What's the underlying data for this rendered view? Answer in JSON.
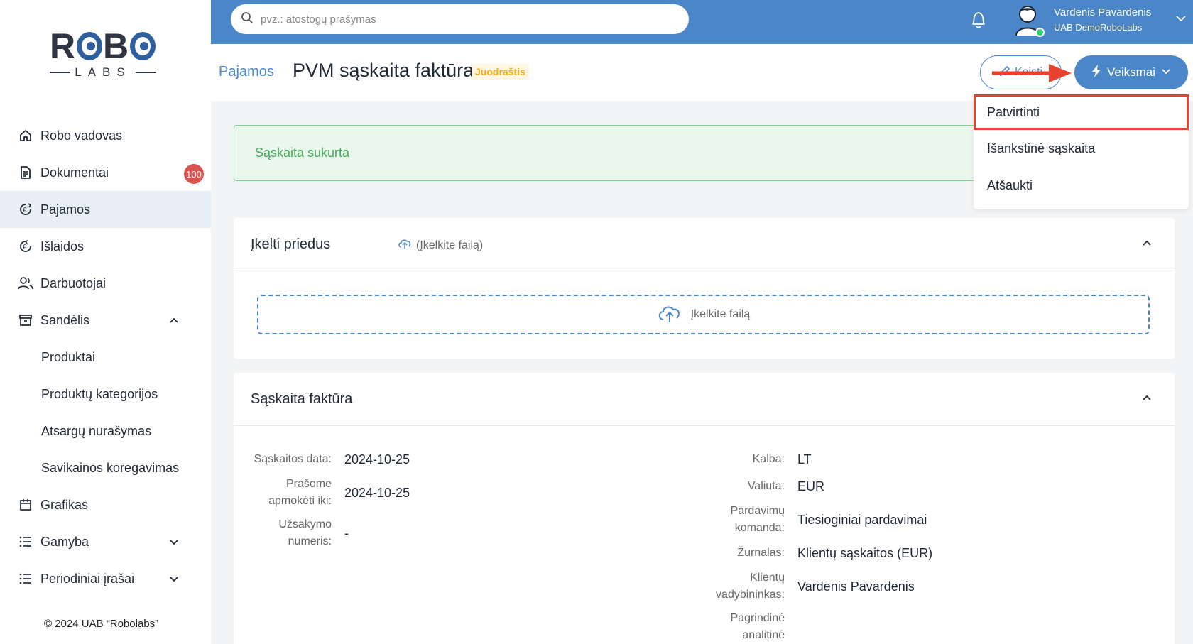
{
  "app": {
    "logo_main_left": "R",
    "logo_main_mid": "B",
    "logo_sub": "LABS",
    "copyright": "© 2024 UAB “Robolabs”"
  },
  "sidebar": {
    "items": [
      {
        "label": "Robo vadovas",
        "icon": "home-icon"
      },
      {
        "label": "Dokumentai",
        "icon": "document-icon",
        "badge": "100"
      },
      {
        "label": "Pajamos",
        "icon": "income-icon"
      },
      {
        "label": "Išlaidos",
        "icon": "expense-icon"
      },
      {
        "label": "Darbuotojai",
        "icon": "users-icon"
      },
      {
        "label": "Sandėlis",
        "icon": "archive-icon"
      },
      {
        "label": "Grafikas",
        "icon": "calendar-icon"
      },
      {
        "label": "Gamyba",
        "icon": "list-icon"
      },
      {
        "label": "Periodiniai įrašai",
        "icon": "list-icon"
      }
    ],
    "sub_items": [
      "Produktai",
      "Produktų kategorijos",
      "Atsargų nurašymas",
      "Savikainos koregavimas"
    ]
  },
  "topbar": {
    "search_placeholder": "pvz.: atostogų prašymas",
    "user_name": "Vardenis Pavardenis",
    "user_company": "UAB DemoRoboLabs"
  },
  "header": {
    "breadcrumb": "Pajamos",
    "title": "PVM sąskaita faktūra",
    "status": "Juodraštis",
    "edit_label": "Keisti",
    "actions_label": "Veiksmai"
  },
  "dropdown": {
    "items": [
      "Patvirtinti",
      "Išankstinė sąskaita",
      "Atšaukti"
    ]
  },
  "alert": {
    "text": "Sąskaita sukurta"
  },
  "attachments": {
    "title": "Įkelti priedus",
    "upload_link": "(Įkelkite failą)",
    "dropzone_text": "Įkelkite failą"
  },
  "invoice": {
    "title": "Sąskaita faktūra",
    "left": [
      {
        "label": "Sąskaitos data:",
        "value": "2024-10-25"
      },
      {
        "label_line1": "Prašome",
        "label_line2": "apmokėti iki:",
        "value": "2024-10-25"
      },
      {
        "label_line1": "Užsakymo",
        "label_line2": "numeris:",
        "value": "-"
      }
    ],
    "right": [
      {
        "label": "Kalba:",
        "value": "LT"
      },
      {
        "label": "Valiuta:",
        "value": "EUR"
      },
      {
        "label_line1": "Pardavimų",
        "label_line2": "komanda:",
        "value": "Tiesioginiai pardavimai"
      },
      {
        "label": "Žurnalas:",
        "value": "Klientų sąskaitos (EUR)"
      },
      {
        "label_line1": "Klientų",
        "label_line2": "vadybininkas:",
        "value": "Vardenis Pavardenis"
      },
      {
        "label_line1": "Pagrindinė",
        "label_line2": "analitinė"
      }
    ]
  },
  "colors": {
    "primary": "#4a86c8",
    "highlight": "#e8412d",
    "success": "#43a856",
    "badge": "#d9534f",
    "draft": "#f0ad1e"
  }
}
